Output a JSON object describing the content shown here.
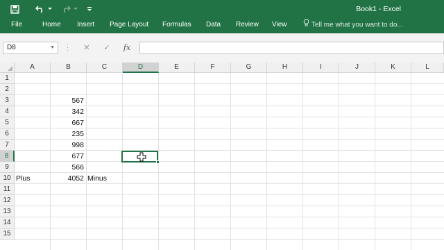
{
  "window": {
    "title": "Book1 - Excel"
  },
  "quick_access": {
    "icons": [
      "save-icon",
      "undo-icon",
      "redo-icon",
      "customize-icon"
    ]
  },
  "ribbon": {
    "tabs": [
      "File",
      "Home",
      "Insert",
      "Page Layout",
      "Formulas",
      "Data",
      "Review",
      "View"
    ],
    "tell_me": "Tell me what you want to do..."
  },
  "formula_bar": {
    "name_box": "D8",
    "formula": "",
    "icons": [
      "cancel-icon",
      "enter-icon",
      "insert-function-icon"
    ],
    "fx_label": "fx"
  },
  "grid": {
    "columns": [
      "A",
      "B",
      "C",
      "D",
      "E",
      "F",
      "G",
      "H",
      "I",
      "J",
      "K",
      "L"
    ],
    "rows": [
      "1",
      "2",
      "3",
      "4",
      "5",
      "6",
      "7",
      "8",
      "9",
      "10",
      "11",
      "12",
      "13",
      "14",
      "15"
    ],
    "selected_cell": "D8",
    "cells": {
      "B3": "567",
      "B4": "342",
      "B5": "667",
      "B6": "235",
      "B7": "998",
      "B8": "677",
      "B9": "566",
      "A10": "Plus",
      "B10": "4052",
      "C10": "Minus"
    }
  },
  "colors": {
    "accent": "#217346",
    "header_bg": "#f0f0f0",
    "gridline": "#e1e1e1"
  }
}
